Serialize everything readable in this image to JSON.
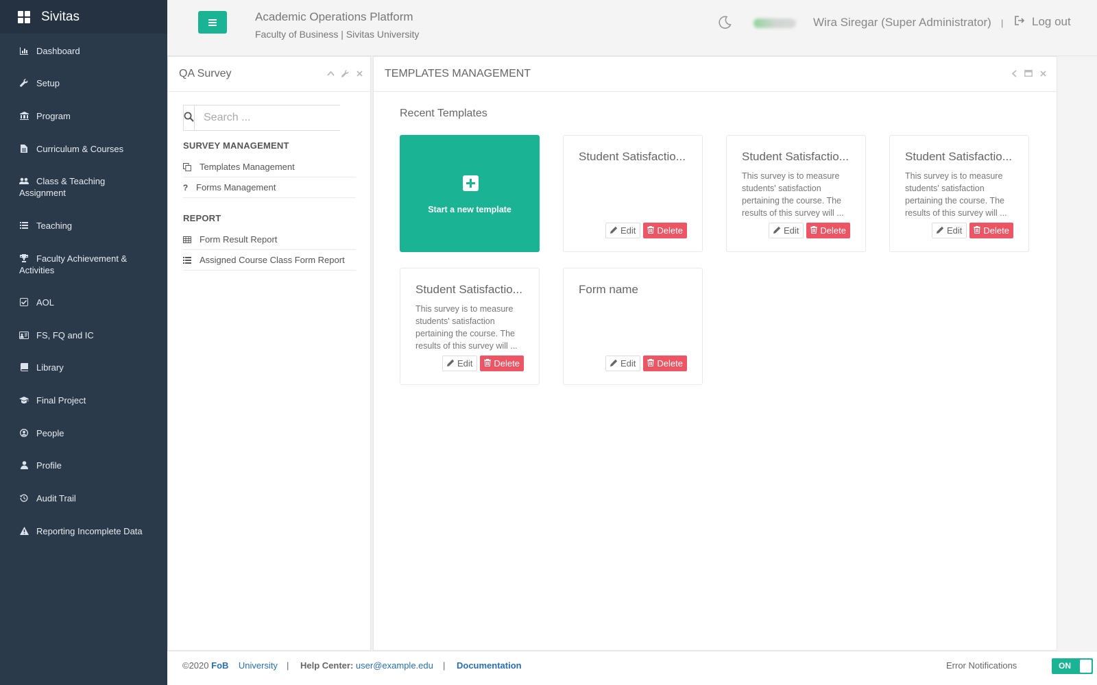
{
  "sidebar": {
    "brand": "Sivitas",
    "items": [
      {
        "label": "Dashboard",
        "icon": "bar-chart-icon"
      },
      {
        "label": "Setup",
        "icon": "wrench-icon"
      },
      {
        "label": "Program",
        "icon": "institution-icon"
      },
      {
        "label": "Curriculum & Courses",
        "icon": "file-text-icon"
      },
      {
        "label": "Class & Teaching Assignment",
        "icon": "users-icon"
      },
      {
        "label": "Teaching",
        "icon": "list-icon"
      },
      {
        "label": "Faculty Achievement & Activities",
        "icon": "trophy-icon"
      },
      {
        "label": "AOL",
        "icon": "check-square-icon"
      },
      {
        "label": "FS, FQ and IC",
        "icon": "id-card-icon"
      },
      {
        "label": "Library",
        "icon": "book-icon"
      },
      {
        "label": "Final Project",
        "icon": "graduation-cap-icon"
      },
      {
        "label": "People",
        "icon": "user-circle-icon"
      },
      {
        "label": "Profile",
        "icon": "user-icon"
      },
      {
        "label": "Audit Trail",
        "icon": "history-icon"
      },
      {
        "label": "Reporting Incomplete Data",
        "icon": "warning-icon"
      }
    ]
  },
  "header": {
    "app_title": "Academic Operations Platform",
    "subtitle": "Faculty of Business | Sivitas University",
    "user": "Wira Siregar (Super Administrator)",
    "separator": "|",
    "logout": "Log out"
  },
  "qa_panel": {
    "title": "QA Survey",
    "search_placeholder": "Search ...",
    "survey_section": "SURVEY MANAGEMENT",
    "survey_items": [
      "Templates Management",
      "Forms Management"
    ],
    "report_section": "REPORT",
    "report_items": [
      "Form Result Report",
      "Assigned Course Class Form Report"
    ]
  },
  "templates_panel": {
    "title": "TEMPLATES MANAGEMENT",
    "recent_title": "Recent Templates",
    "new_template": "Start a new template",
    "edit_label": "Edit",
    "delete_label": "Delete",
    "cards": [
      {
        "title": "Student Satisfactio...",
        "desc": ""
      },
      {
        "title": "Student Satisfactio...",
        "desc": "This survey is to measure students' satisfaction pertaining the course. The results of this survey will ..."
      },
      {
        "title": "Student Satisfactio...",
        "desc": "This survey is to measure students' satisfaction pertaining the course. The results of this survey will ..."
      },
      {
        "title": "Student Satisfactio...",
        "desc": "This survey is to measure students' satisfaction pertaining the course. The results of this survey will ..."
      },
      {
        "title": "Form name",
        "desc": ""
      }
    ]
  },
  "footer": {
    "copyright": "©2020",
    "fob": "FoB",
    "university": "University",
    "pipe": "|",
    "help_label": "Help Center:",
    "help_email": "user@example.edu",
    "documentation": "Documentation",
    "error_notifications": "Error Notifications",
    "toggle_state": "ON"
  },
  "colors": {
    "accent": "#1ab394",
    "danger": "#ed5565",
    "sidebar": "#2b3a4a"
  }
}
